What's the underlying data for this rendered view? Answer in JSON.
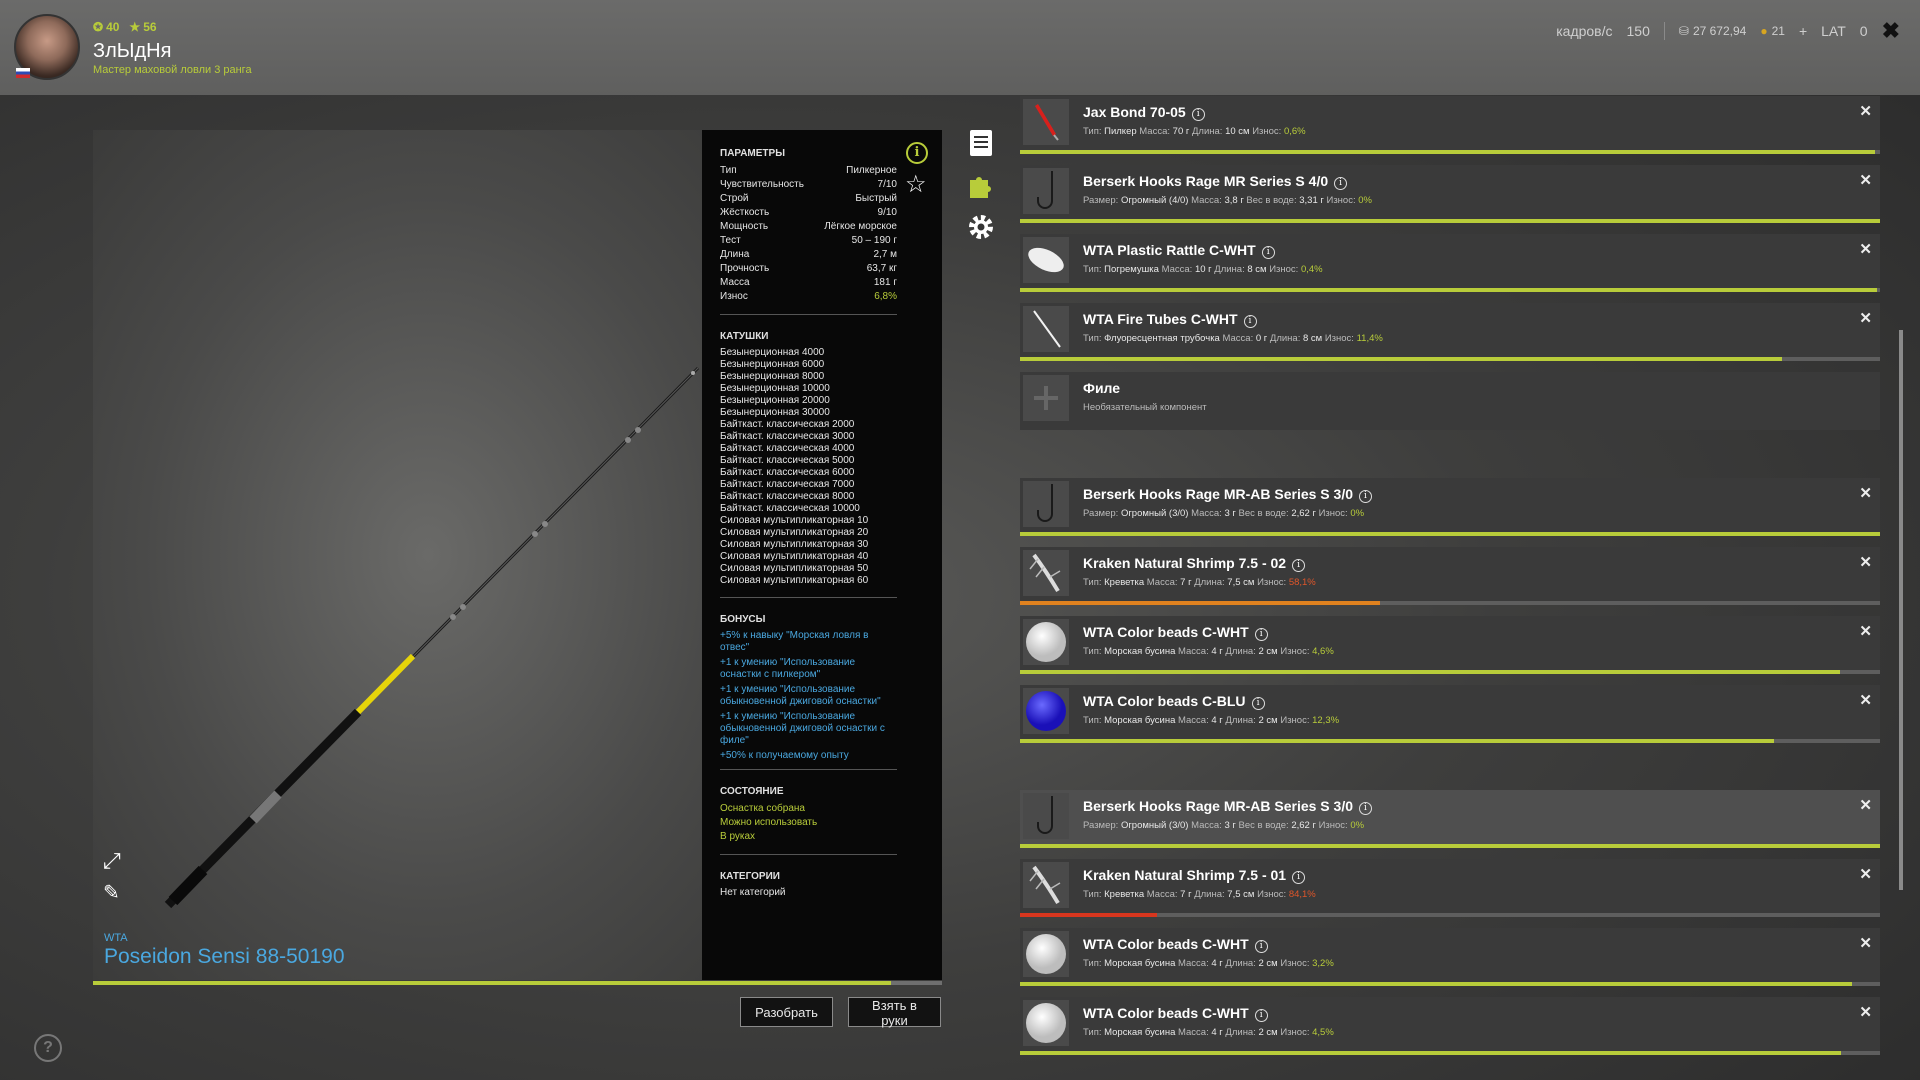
{
  "player": {
    "name": "ЗлЫдНя",
    "title": "Мастер маховой ловли 3 ранга",
    "level": "40",
    "stars": "56"
  },
  "hud": {
    "fps_label": "кадров/с",
    "fps_value": "150",
    "currency1": "27 672,94",
    "currency2": "21",
    "hud_text": "LAT",
    "lat_value": "0"
  },
  "rod": {
    "brand": "WTA",
    "name": "Poseidon Sensi 88-50190",
    "wear": 0.94
  },
  "params": {
    "header": "ПАРАМЕТРЫ",
    "rows": [
      {
        "label": "Тип",
        "value": "Пилкерное"
      },
      {
        "label": "Чувствительность",
        "value": "7/10"
      },
      {
        "label": "Строй",
        "value": "Быстрый"
      },
      {
        "label": "Жёсткость",
        "value": "9/10"
      },
      {
        "label": "Мощность",
        "value": "Лёгкое морское"
      },
      {
        "label": "Тест",
        "value": "50 – 190 г"
      },
      {
        "label": "Длина",
        "value": "2,7 м"
      },
      {
        "label": "Прочность",
        "value": "63,7 кг"
      },
      {
        "label": "Масса",
        "value": "181 г"
      },
      {
        "label": "Износ",
        "value": "6,8%"
      }
    ],
    "reels_header": "КАТУШКИ",
    "reels": [
      "Безынерционная 4000",
      "Безынерционная 6000",
      "Безынерционная 8000",
      "Безынерционная 10000",
      "Безынерционная 20000",
      "Безынерционная 30000",
      "Байткаст. классическая 2000",
      "Байткаст. классическая 3000",
      "Байткаст. классическая 4000",
      "Байткаст. классическая 5000",
      "Байткаст. классическая 6000",
      "Байткаст. классическая 7000",
      "Байткаст. классическая 8000",
      "Байткаст. классическая 10000",
      "Силовая мультипликаторная 10",
      "Силовая мультипликаторная 20",
      "Силовая мультипликаторная 30",
      "Силовая мультипликаторная 40",
      "Силовая мультипликаторная 50",
      "Силовая мультипликаторная 60"
    ],
    "bonuses_header": "БОНУСЫ",
    "bonuses": [
      "+5% к навыку \"Морская ловля в отвес\"",
      "+1 к умению \"Использование оснастки с пилкером\"",
      "+1 к умению \"Использование обыкновенной джиговой оснастки\"",
      "+1 к умению \"Использование обыкновенной джиговой оснастки с филе\"",
      "+50% к получаемому опыту"
    ],
    "state_header": "СОСТОЯНИЕ",
    "states": [
      "Оснастка собрана",
      "Можно использовать",
      "В руках"
    ],
    "categories_header": "КАТЕГОРИИ",
    "categories_value": "Нет категорий"
  },
  "buttons": {
    "disassemble": "Разобрать",
    "take": "Взять в руки"
  },
  "items": [
    {
      "name": "Jax Bond 70-05",
      "thumb": "pilker",
      "desc": [
        [
          "Тип:",
          "Пилкер"
        ],
        [
          "Масса:",
          "70 г"
        ],
        [
          "Длина:",
          "10 см"
        ]
      ],
      "wear_label": "Износ:",
      "wear_text": "0,6%",
      "wear": 0.994,
      "bar": "green",
      "selected": false,
      "closable": true
    },
    {
      "name": "Berserk Hooks Rage MR Series S 4/0",
      "thumb": "hook",
      "desc": [
        [
          "Размер:",
          "Огромный (4/0)"
        ],
        [
          "Масса:",
          "3,8 г"
        ],
        [
          "Вес в воде:",
          "3,31 г"
        ]
      ],
      "wear_label": "Износ:",
      "wear_text": "0%",
      "wear": 1.0,
      "bar": "green",
      "selected": false,
      "closable": true
    },
    {
      "name": "WTA Plastic Rattle C-WHT",
      "thumb": "rattle",
      "desc": [
        [
          "Тип:",
          "Погремушка"
        ],
        [
          "Масса:",
          "10 г"
        ],
        [
          "Длина:",
          "8 см"
        ]
      ],
      "wear_label": "Износ:",
      "wear_text": "0,4%",
      "wear": 0.996,
      "bar": "green",
      "selected": false,
      "closable": true
    },
    {
      "name": "WTA Fire Tubes C-WHT",
      "thumb": "tube",
      "desc": [
        [
          "Тип:",
          "Флуоресцентная трубочка"
        ],
        [
          "Масса:",
          "0 г"
        ],
        [
          "Длина:",
          "8 см"
        ]
      ],
      "wear_label": "Износ:",
      "wear_text": "11,4%",
      "wear": 0.886,
      "bar": "green",
      "selected": false,
      "closable": true
    },
    {
      "name": "Филе",
      "thumb": "plus",
      "desc": [],
      "wear_label": "",
      "wear_text": "",
      "extra": "Необязательный компонент",
      "wear": null,
      "bar": "none",
      "selected": false,
      "closable": false
    },
    {
      "name": "Berserk Hooks Rage MR-AB Series S 3/0",
      "thumb": "hook",
      "desc": [
        [
          "Размер:",
          "Огромный (3/0)"
        ],
        [
          "Масса:",
          "3 г"
        ],
        [
          "Вес в воде:",
          "2,62 г"
        ]
      ],
      "wear_label": "Износ:",
      "wear_text": "0%",
      "wear": 1.0,
      "bar": "green",
      "selected": false,
      "closable": true
    },
    {
      "name": "Kraken Natural Shrimp 7.5 - 02",
      "thumb": "shrimp",
      "desc": [
        [
          "Тип:",
          "Креветка"
        ],
        [
          "Масса:",
          "7 г"
        ],
        [
          "Длина:",
          "7,5 см"
        ]
      ],
      "wear_label": "Износ:",
      "wear_text": "58,1%",
      "wear": 0.419,
      "bar": "orange",
      "selected": false,
      "closable": true
    },
    {
      "name": "WTA Color beads C-WHT",
      "thumb": "bead-white",
      "desc": [
        [
          "Тип:",
          "Морская бусина"
        ],
        [
          "Масса:",
          "4 г"
        ],
        [
          "Длина:",
          "2 см"
        ]
      ],
      "wear_label": "Износ:",
      "wear_text": "4,6%",
      "wear": 0.954,
      "bar": "green",
      "selected": false,
      "closable": true
    },
    {
      "name": "WTA Color beads C-BLU",
      "thumb": "bead-blue",
      "desc": [
        [
          "Тип:",
          "Морская бусина"
        ],
        [
          "Масса:",
          "4 г"
        ],
        [
          "Длина:",
          "2 см"
        ]
      ],
      "wear_label": "Износ:",
      "wear_text": "12,3%",
      "wear": 0.877,
      "bar": "green",
      "selected": false,
      "closable": true
    },
    {
      "name": "Berserk Hooks Rage MR-AB Series S 3/0",
      "thumb": "hook",
      "desc": [
        [
          "Размер:",
          "Огромный (3/0)"
        ],
        [
          "Масса:",
          "3 г"
        ],
        [
          "Вес в воде:",
          "2,62 г"
        ]
      ],
      "wear_label": "Износ:",
      "wear_text": "0%",
      "wear": 1.0,
      "bar": "green",
      "selected": true,
      "closable": true
    },
    {
      "name": "Kraken Natural Shrimp 7.5 - 01",
      "thumb": "shrimp",
      "desc": [
        [
          "Тип:",
          "Креветка"
        ],
        [
          "Масса:",
          "7 г"
        ],
        [
          "Длина:",
          "7,5 см"
        ]
      ],
      "wear_label": "Износ:",
      "wear_text": "84,1%",
      "wear": 0.159,
      "bar": "red",
      "selected": false,
      "closable": true
    },
    {
      "name": "WTA Color beads C-WHT",
      "thumb": "bead-white",
      "desc": [
        [
          "Тип:",
          "Морская бусина"
        ],
        [
          "Масса:",
          "4 г"
        ],
        [
          "Длина:",
          "2 см"
        ]
      ],
      "wear_label": "Износ:",
      "wear_text": "3,2%",
      "wear": 0.968,
      "bar": "green",
      "selected": false,
      "closable": true
    },
    {
      "name": "WTA Color beads C-WHT",
      "thumb": "bead-white",
      "desc": [
        [
          "Тип:",
          "Морская бусина"
        ],
        [
          "Масса:",
          "4 г"
        ],
        [
          "Длина:",
          "2 см"
        ]
      ],
      "wear_label": "Износ:",
      "wear_text": "4,5%",
      "wear": 0.955,
      "bar": "green",
      "selected": false,
      "closable": true
    }
  ],
  "colors": {
    "accent_green": "#b8cc3a",
    "link_blue": "#4aa8e0",
    "wear_orange": "#e0821f",
    "wear_red": "#d8361e"
  }
}
